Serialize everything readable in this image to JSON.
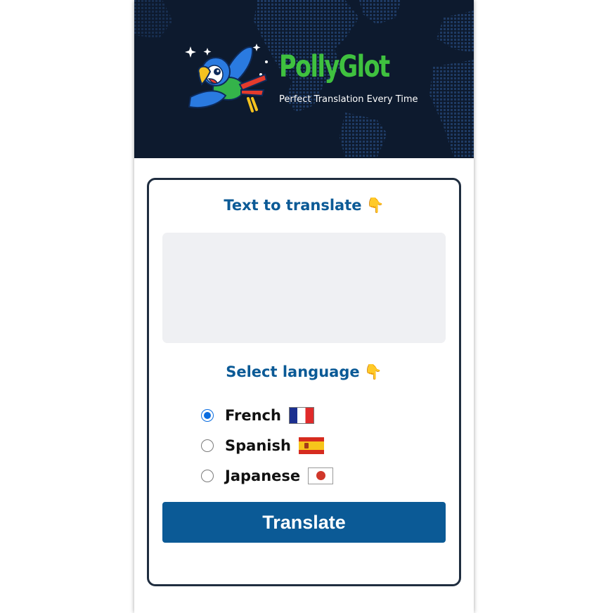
{
  "brand": {
    "title": "PollyGlot",
    "tagline": "Perfect Translation Every Time",
    "logo_icon": "parrot-icon",
    "background_icon": "world-map-icon"
  },
  "translate_section": {
    "title": "Text to translate",
    "title_icon": "pointing-down-hand-icon",
    "title_emoji": "👇",
    "input_value": "",
    "input_placeholder": ""
  },
  "language_section": {
    "title": "Select language",
    "title_icon": "pointing-down-hand-icon",
    "title_emoji": "👇",
    "options": [
      {
        "label": "French",
        "flag_icon": "france-flag-icon",
        "selected": true
      },
      {
        "label": "Spanish",
        "flag_icon": "spain-flag-icon",
        "selected": false
      },
      {
        "label": "Japanese",
        "flag_icon": "japan-flag-icon",
        "selected": false
      }
    ]
  },
  "actions": {
    "translate_label": "Translate"
  },
  "colors": {
    "header_bg": "#0d1a2e",
    "brand_green": "#3fc13f",
    "accent_blue": "#0b5a96",
    "card_border": "#1f2d3f",
    "input_bg": "#eff0f3",
    "radio_selected": "#0a6de0"
  }
}
